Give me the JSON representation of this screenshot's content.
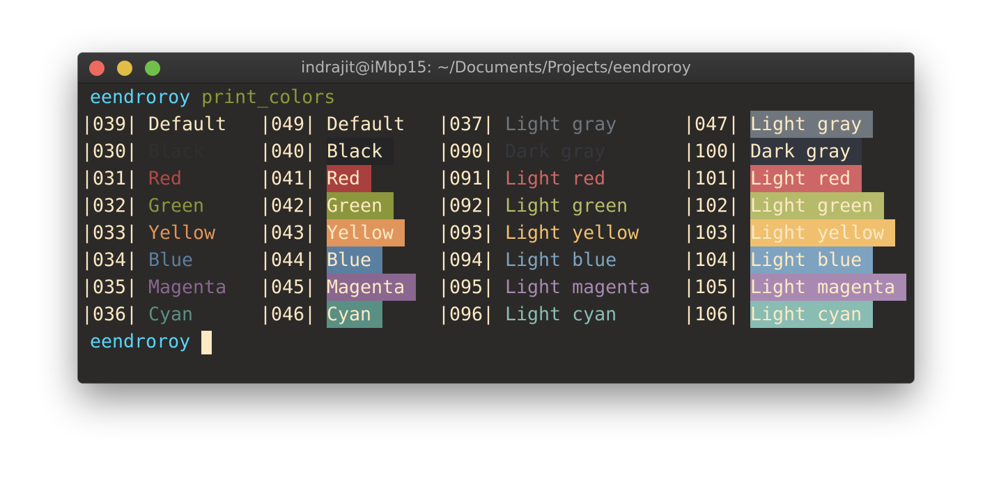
{
  "window": {
    "title": "indrajit@iMbp15: ~/Documents/Projects/eendroroy",
    "buttons": {
      "close": "#ed6a5e",
      "minimize": "#e0bd47",
      "zoom": "#6fc14a"
    }
  },
  "prompt": {
    "user": "eendroroy",
    "command": "print_colors",
    "user_color": "#5bd4f8",
    "command_color": "#8a9a3a"
  },
  "default_fg": "#fde9c4",
  "rows": [
    [
      {
        "code": "|039|",
        "label": "Default ",
        "fg": "#fde9c4"
      },
      {
        "code": "|049|",
        "label": "Default ",
        "bg": null
      },
      {
        "code": "|037|",
        "label": "Light gray ",
        "fg": "#6f767d"
      },
      {
        "code": "|047|",
        "label": "Light gray ",
        "bg": "#6f767d"
      }
    ],
    [
      {
        "code": "|030|",
        "label": "Black ",
        "fg": "#2f2f30"
      },
      {
        "code": "|040|",
        "label": "Black ",
        "bg": "#252527"
      },
      {
        "code": "|090|",
        "label": "Dark gray ",
        "fg": "#34363d"
      },
      {
        "code": "|100|",
        "label": "Dark gray ",
        "bg": "#33363e"
      }
    ],
    [
      {
        "code": "|031|",
        "label": "Red ",
        "fg": "#b14a48"
      },
      {
        "code": "|041|",
        "label": "Red ",
        "bg": "#a8403f"
      },
      {
        "code": "|091|",
        "label": "Light red ",
        "fg": "#cd6666"
      },
      {
        "code": "|101|",
        "label": "Light red ",
        "bg": "#cd6666"
      }
    ],
    [
      {
        "code": "|032|",
        "label": "Green ",
        "fg": "#8c963c"
      },
      {
        "code": "|042|",
        "label": "Green ",
        "bg": "#8c963c"
      },
      {
        "code": "|092|",
        "label": "Light green ",
        "fg": "#b5bb6a"
      },
      {
        "code": "|102|",
        "label": "Light green ",
        "bg": "#b5bb6a"
      }
    ],
    [
      {
        "code": "|033|",
        "label": "Yellow ",
        "fg": "#e0955c"
      },
      {
        "code": "|043|",
        "label": "Yellow ",
        "bg": "#e0955c"
      },
      {
        "code": "|093|",
        "label": "Light yellow ",
        "fg": "#f0c06f"
      },
      {
        "code": "|103|",
        "label": "Light yellow ",
        "bg": "#f0c06f"
      }
    ],
    [
      {
        "code": "|034|",
        "label": "Blue ",
        "fg": "#5b7fa0"
      },
      {
        "code": "|044|",
        "label": "Blue ",
        "bg": "#5b7fa0"
      },
      {
        "code": "|094|",
        "label": "Light blue ",
        "fg": "#7ea3c0"
      },
      {
        "code": "|104|",
        "label": "Light blue ",
        "bg": "#7ea3c0"
      }
    ],
    [
      {
        "code": "|035|",
        "label": "Magenta ",
        "fg": "#8a6790"
      },
      {
        "code": "|045|",
        "label": "Magenta ",
        "bg": "#8a6790"
      },
      {
        "code": "|095|",
        "label": "Light magenta ",
        "fg": "#a889b2"
      },
      {
        "code": "|105|",
        "label": "Light magenta ",
        "bg": "#a889b2"
      }
    ],
    [
      {
        "code": "|036|",
        "label": "Cyan ",
        "fg": "#5a8f84"
      },
      {
        "code": "|046|",
        "label": "Cyan ",
        "bg": "#5a8f84"
      },
      {
        "code": "|096|",
        "label": "Light cyan ",
        "fg": "#89bdb3"
      },
      {
        "code": "|106|",
        "label": "Light cyan ",
        "bg": "#89bdb3"
      }
    ]
  ],
  "final_prompt": {
    "user": "eendroroy"
  }
}
